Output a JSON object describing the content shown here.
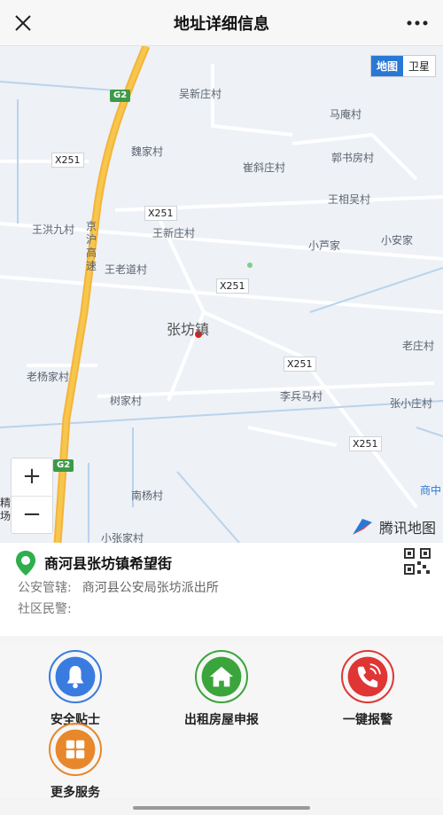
{
  "header": {
    "title": "地址详细信息",
    "close_icon": "close-icon",
    "more_icon": "more-icon"
  },
  "map": {
    "toggle": {
      "map": "地图",
      "satellite": "卫星",
      "selected": "地图"
    },
    "places": [
      "吴新庄村",
      "马庵村",
      "魏家村",
      "崔斜庄村",
      "郭书房村",
      "王相吴村",
      "王洪九村",
      "王新庄村",
      "小芦家",
      "小安家",
      "王老道村",
      "老庄村",
      "老杨家村",
      "树家村",
      "李兵马村",
      "张小庄村",
      "南杨村",
      "小张家村"
    ],
    "town": "张坊镇",
    "highway_label": "京沪高速",
    "roads": [
      "X251",
      "X251",
      "X251",
      "X251",
      "X251"
    ],
    "highway_tags": [
      "G2",
      "G2"
    ],
    "edge_labels": [
      "商中",
      "精场"
    ],
    "zoom_in": "+",
    "zoom_out": "−",
    "provider": "腾讯地图"
  },
  "address": {
    "name": "商河县张坊镇希望街",
    "police_label": "公安管辖:",
    "police_value": "商河县公安局张坊派出所",
    "community_label": "社区民警:",
    "community_value": ""
  },
  "services": [
    {
      "label": "安全贴士",
      "icon": "bell-icon",
      "color": "#3a7be0"
    },
    {
      "label": "出租房屋申报",
      "icon": "house-icon",
      "color": "#3aa53a"
    },
    {
      "label": "一键报警",
      "icon": "phone-icon",
      "color": "#e03535"
    },
    {
      "label": "更多服务",
      "icon": "grid-icon",
      "color": "#e8872b"
    }
  ]
}
